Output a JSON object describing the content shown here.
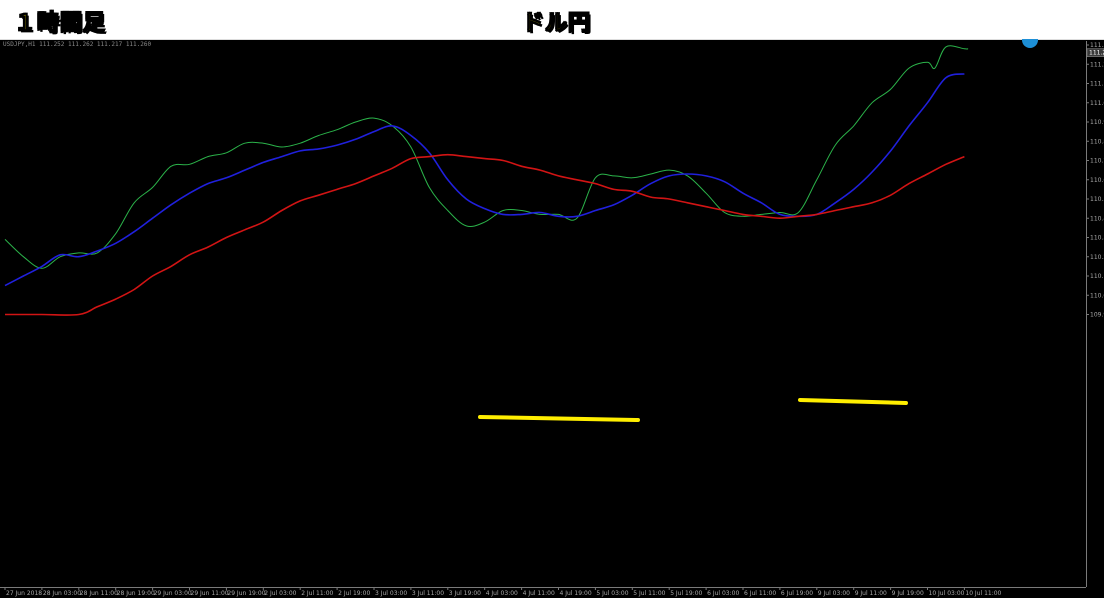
{
  "header": {
    "timeframe_label": "１時間足",
    "pair_label": "ドル円"
  },
  "symbol_info": "USDJPY,H1  111.252 111.262 111.217 111.260",
  "colors": {
    "background": "#000000",
    "axis": "#7a7a7a",
    "green_line": "#2bb34a",
    "blue_line": "#2020dd",
    "red_line": "#d21414",
    "support_marker": "#ffee00",
    "banner_text": "#fff000"
  },
  "chart_data": {
    "type": "line",
    "title": "ドル円",
    "symbol": "USDJPY,H1",
    "ylim": [
      109.9,
      111.3
    ],
    "y_ticks": [
      111.3,
      111.2,
      111.1,
      111.0,
      110.9,
      110.8,
      110.7,
      110.6,
      110.5,
      110.4,
      110.3,
      110.2,
      110.1,
      110.0,
      109.9
    ],
    "price_marker": "111.2",
    "x_ticks": [
      "27 Jun 2018",
      "28 Jun 03:00",
      "28 Jun 11:00",
      "28 Jun 19:00",
      "29 Jun 03:00",
      "29 Jun 11:00",
      "29 Jun 19:00",
      "2 Jul 03:00",
      "2 Jul 11:00",
      "2 Jul 19:00",
      "3 Jul 03:00",
      "3 Jul 11:00",
      "3 Jul 19:00",
      "4 Jul 03:00",
      "4 Jul 11:00",
      "4 Jul 19:00",
      "5 Jul 03:00",
      "5 Jul 11:00",
      "5 Jul 19:00",
      "6 Jul 03:00",
      "6 Jul 11:00",
      "6 Jul 19:00",
      "9 Jul 03:00",
      "9 Jul 11:00",
      "9 Jul 19:00",
      "10 Jul 03:00",
      "10 Jul 11:00"
    ],
    "series": [
      {
        "color": "#2bb34a",
        "x": [
          0,
          0.5,
          1,
          1.5,
          2,
          2.5,
          3,
          3.5,
          4,
          4.5,
          5,
          5.5,
          6,
          6.5,
          7,
          7.5,
          8,
          8.5,
          9,
          9.5,
          10,
          10.5,
          11,
          11.5,
          12,
          12.5,
          13,
          13.5,
          14,
          14.5,
          15,
          15.5,
          16,
          16.5,
          17,
          17.5,
          18,
          18.5,
          19,
          19.5,
          20,
          20.5,
          21,
          21.5,
          22,
          22.5,
          23,
          23.5,
          24,
          24.5,
          25,
          25.2,
          25.5,
          26,
          26.1
        ],
        "values": [
          110.29,
          110.2,
          110.14,
          110.2,
          110.22,
          110.22,
          110.32,
          110.48,
          110.56,
          110.67,
          110.68,
          110.72,
          110.74,
          110.79,
          110.79,
          110.77,
          110.79,
          110.83,
          110.86,
          110.9,
          110.92,
          110.88,
          110.77,
          110.56,
          110.44,
          110.36,
          110.38,
          110.44,
          110.44,
          110.42,
          110.42,
          110.4,
          110.61,
          110.62,
          110.61,
          110.63,
          110.65,
          110.62,
          110.53,
          110.43,
          110.41,
          110.42,
          110.43,
          110.43,
          110.6,
          110.78,
          110.88,
          111.0,
          111.07,
          111.18,
          111.21,
          111.18,
          111.29,
          111.28,
          111.28
        ]
      },
      {
        "color": "#2020dd",
        "x": [
          0,
          0.5,
          1,
          1.5,
          2,
          2.5,
          3,
          3.5,
          4,
          4.5,
          5,
          5.5,
          6,
          6.5,
          7,
          7.5,
          8,
          8.5,
          9,
          9.5,
          10,
          10.5,
          11,
          11.5,
          12,
          12.5,
          13,
          13.5,
          14,
          14.5,
          15,
          15.5,
          16,
          16.5,
          17,
          17.5,
          18,
          18.5,
          19,
          19.5,
          20,
          20.5,
          21,
          21.5,
          22,
          22.5,
          23,
          23.5,
          24,
          24.5,
          25,
          25.5,
          26
        ],
        "values": [
          110.05,
          110.1,
          110.15,
          110.21,
          110.2,
          110.23,
          110.27,
          110.33,
          110.4,
          110.47,
          110.53,
          110.58,
          110.61,
          110.65,
          110.69,
          110.72,
          110.75,
          110.76,
          110.78,
          110.81,
          110.85,
          110.88,
          110.83,
          110.74,
          110.6,
          110.5,
          110.45,
          110.42,
          110.42,
          110.43,
          110.41,
          110.41,
          110.44,
          110.47,
          110.52,
          110.58,
          110.62,
          110.63,
          110.62,
          110.59,
          110.53,
          110.48,
          110.42,
          110.41,
          110.42,
          110.48,
          110.55,
          110.64,
          110.75,
          110.88,
          111.0,
          111.13,
          111.15
        ]
      },
      {
        "color": "#d21414",
        "x": [
          0,
          1,
          2,
          2.5,
          3,
          3.5,
          4,
          4.5,
          5,
          5.5,
          6,
          6.5,
          7,
          7.5,
          8,
          8.5,
          9,
          9.5,
          10,
          10.5,
          11,
          11.5,
          12,
          12.5,
          13,
          13.5,
          14,
          14.5,
          15,
          15.5,
          16,
          16.5,
          17,
          17.5,
          18,
          18.5,
          19,
          19.5,
          20,
          20.5,
          21,
          21.5,
          22,
          22.5,
          23,
          23.5,
          24,
          24.5,
          25,
          25.5,
          26
        ],
        "values": [
          109.9,
          109.9,
          109.9,
          109.94,
          109.98,
          110.03,
          110.1,
          110.15,
          110.21,
          110.25,
          110.3,
          110.34,
          110.38,
          110.44,
          110.49,
          110.52,
          110.55,
          110.58,
          110.62,
          110.66,
          110.71,
          110.72,
          110.73,
          110.72,
          110.71,
          110.7,
          110.67,
          110.65,
          110.62,
          110.6,
          110.58,
          110.55,
          110.54,
          110.51,
          110.5,
          110.48,
          110.46,
          110.44,
          110.42,
          110.41,
          110.4,
          110.41,
          110.42,
          110.44,
          110.46,
          110.48,
          110.52,
          110.58,
          110.63,
          110.68,
          110.72
        ]
      }
    ]
  }
}
